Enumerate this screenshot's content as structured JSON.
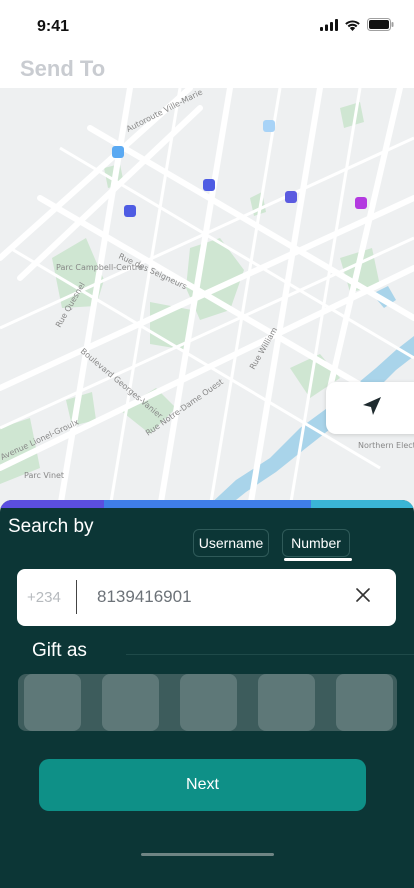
{
  "status_bar": {
    "time": "9:41"
  },
  "header": {
    "title": "Send To"
  },
  "map": {
    "labels": [
      "Parc Campbell-Centre",
      "Rue des Seigneurs",
      "Rue Quesnel",
      "Boulevard Georges-Vanier",
      "Rue Notre-Dame Ouest",
      "Rue William",
      "Avenue Lionel-Groulx",
      "Parc Vinet",
      "Northern Electric Building",
      "Autoroute Ville-Marie"
    ],
    "marker_colors": [
      "#5aa9f2",
      "#a8d3f7",
      "#4e5ce3",
      "#4e5ce3",
      "#5b5be0",
      "#b33ae0"
    ]
  },
  "sheet": {
    "progress_colors": [
      "#5b4ee0",
      "#3f7ee8",
      "#3f7ee8",
      "#3ab5d6"
    ],
    "search_by_label": "Search by",
    "tabs": [
      {
        "label": "Username",
        "active": false
      },
      {
        "label": "Number",
        "active": true
      }
    ],
    "phone": {
      "country_code": "+234",
      "value": "8139416901"
    },
    "gift_as_label": "Gift as",
    "gift_options_count": 5,
    "next_label": "Next"
  },
  "colors": {
    "sheet_bg": "#0c3636",
    "accent": "#0e9087"
  }
}
